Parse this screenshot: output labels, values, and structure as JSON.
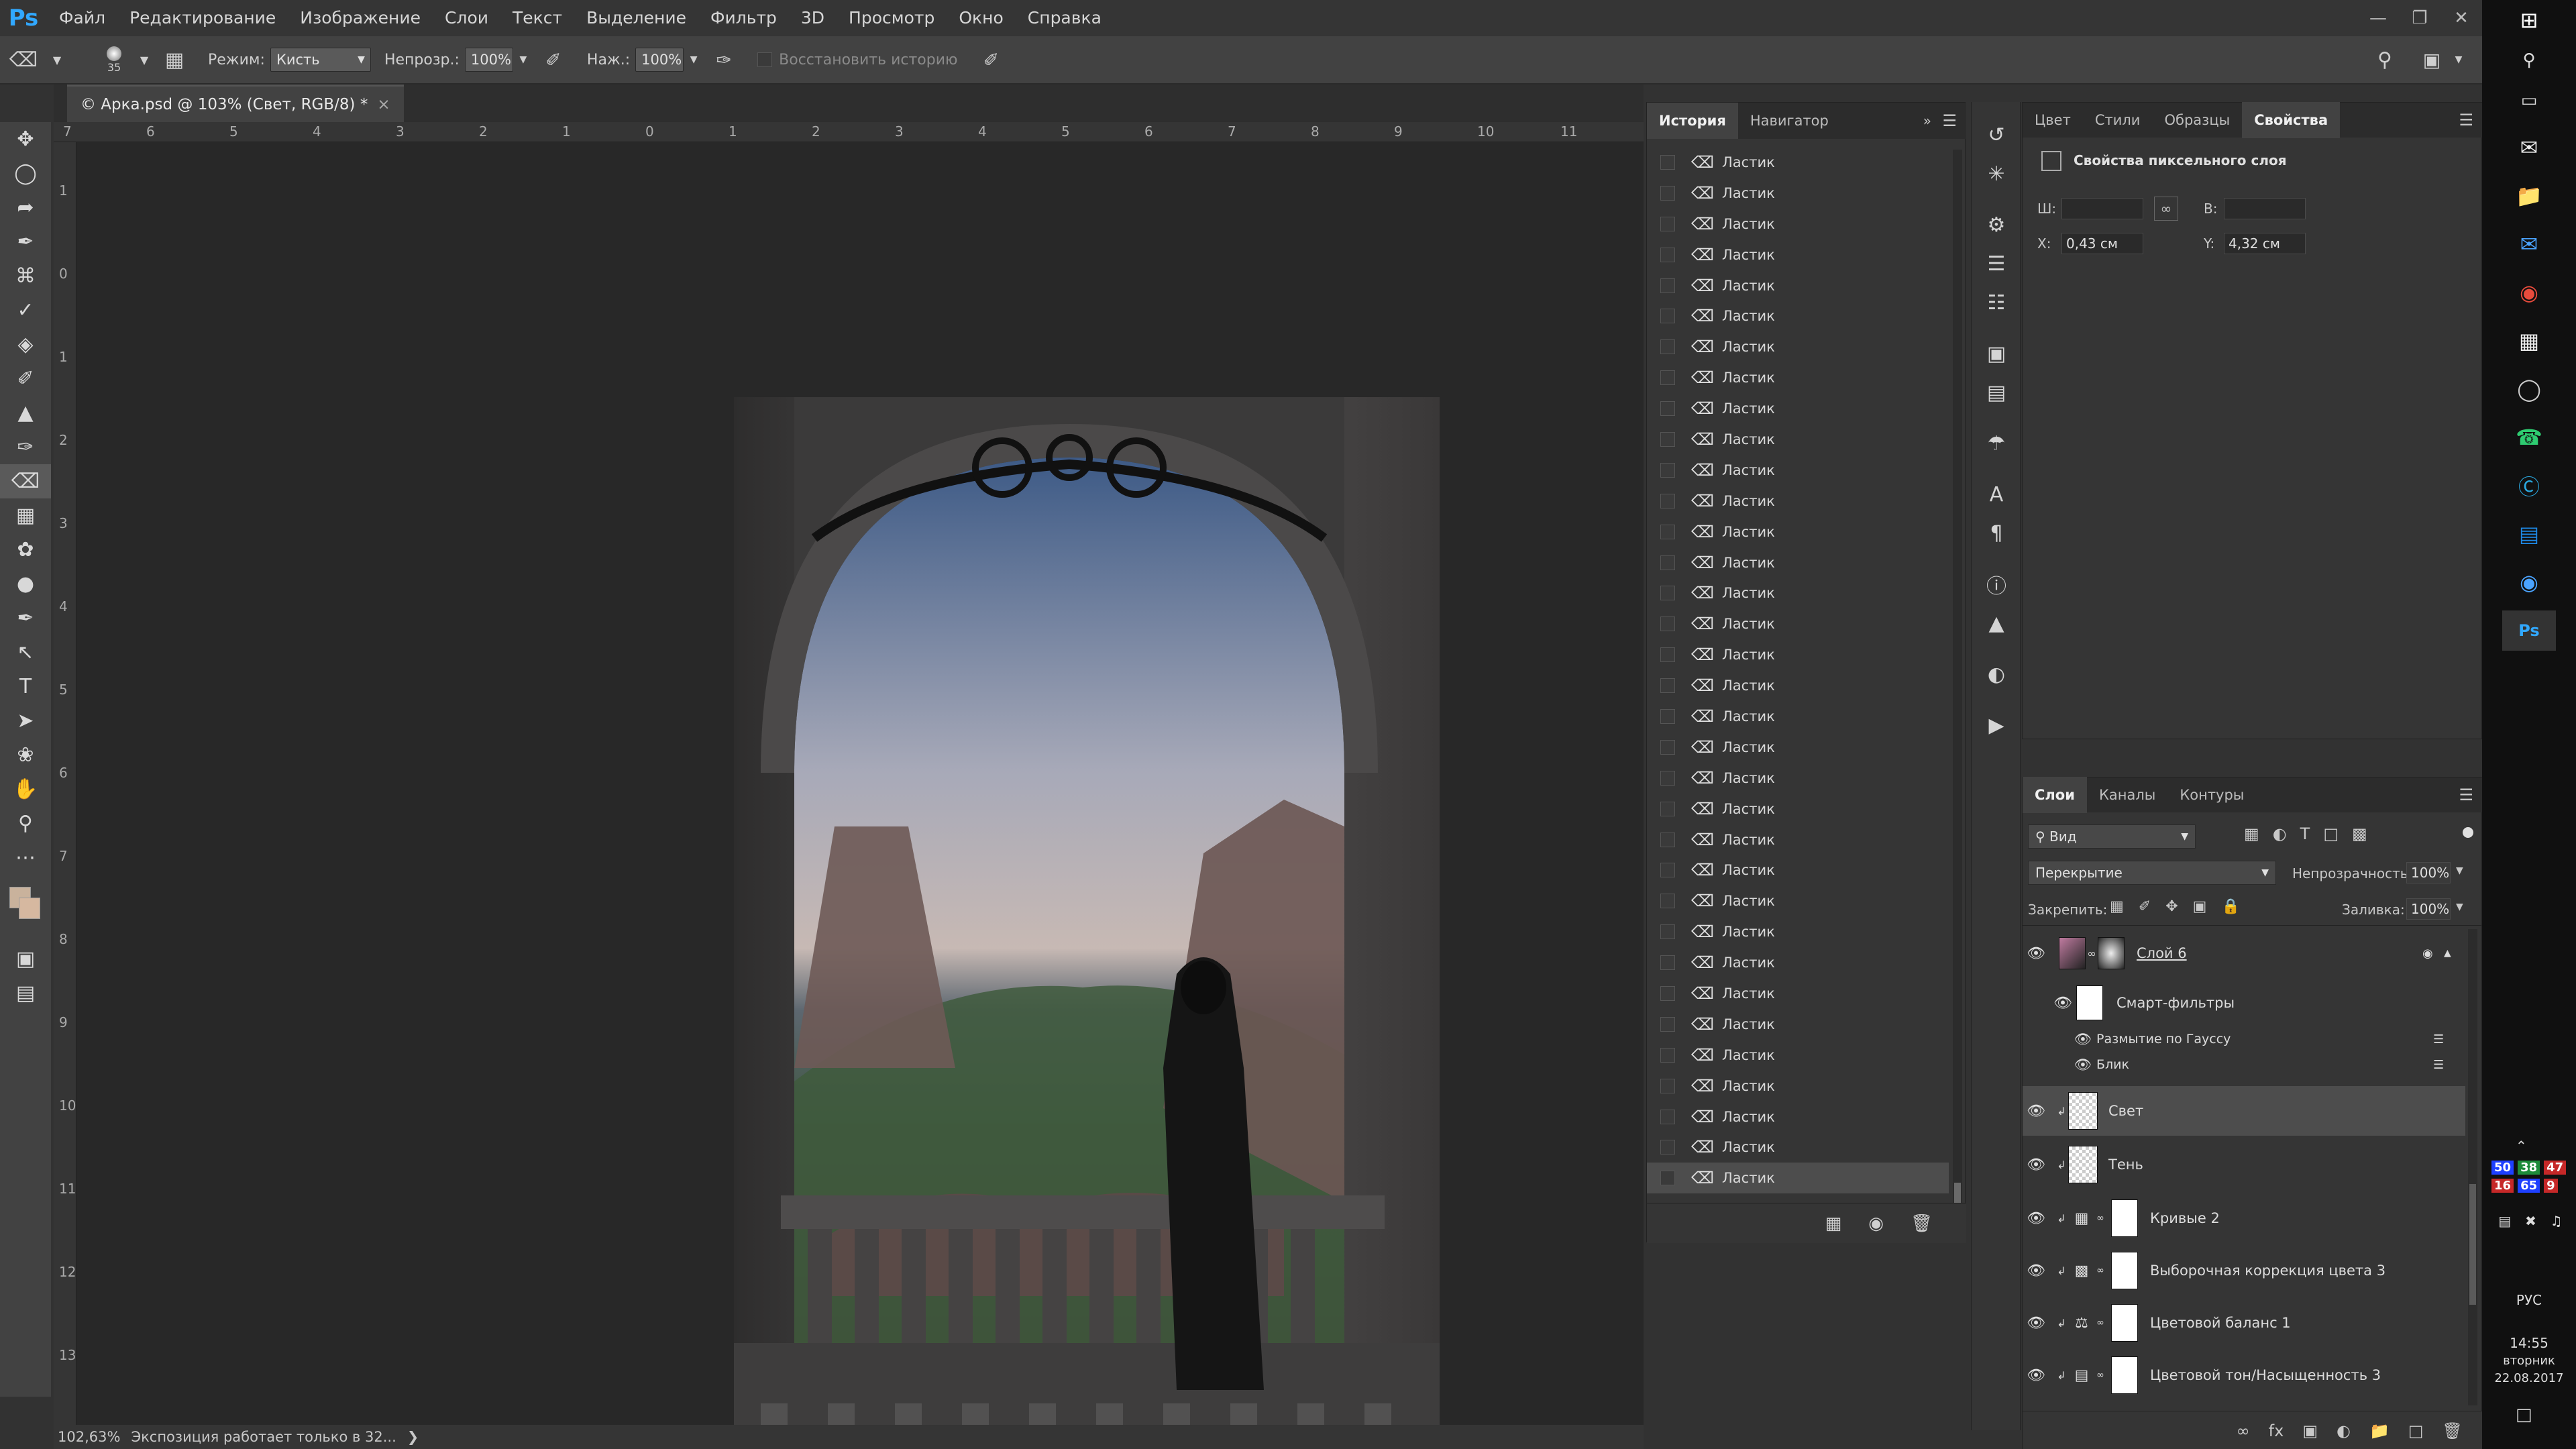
{
  "app": {
    "logo": "Ps"
  },
  "menu": [
    "Файл",
    "Редактирование",
    "Изображение",
    "Слои",
    "Текст",
    "Выделение",
    "Фильтр",
    "3D",
    "Просмотр",
    "Окно",
    "Справка"
  ],
  "options": {
    "brush_size": "35",
    "mode_label": "Режим:",
    "mode_value": "Кисть",
    "opacity_label": "Непрозр.:",
    "opacity_value": "100%",
    "pressure_label": "Наж.:",
    "pressure_value": "100%",
    "restore_history": "Восстановить историю"
  },
  "document": {
    "tab_title": "© Арка.psd @ 103% (Свет, RGB/8) *",
    "close": "×",
    "zoom": "102,63%",
    "status": "Экспозиция работает только в 32...",
    "ruler_top": [
      "7",
      "6",
      "5",
      "4",
      "3",
      "2",
      "1",
      "0",
      "1",
      "2",
      "3",
      "4",
      "5",
      "6",
      "7",
      "8",
      "9",
      "10",
      "11"
    ],
    "ruler_left": [
      "1",
      "0",
      "1",
      "2",
      "3",
      "4",
      "5",
      "6",
      "7",
      "8",
      "9",
      "10",
      "11",
      "12",
      "13"
    ]
  },
  "history": {
    "tabs": [
      "История",
      "Навигатор"
    ],
    "item_label": "Ластик",
    "count": 34
  },
  "properties": {
    "tabs": [
      "Цвет",
      "Стили",
      "Образцы",
      "Свойства"
    ],
    "title": "Свойства пиксельного слоя",
    "w_label": "Ш:",
    "h_label": "В:",
    "x_label": "X:",
    "x_value": "0,43 см",
    "y_label": "Y:",
    "y_value": "4,32 см"
  },
  "layers": {
    "tabs": [
      "Слои",
      "Каналы",
      "Контуры"
    ],
    "filter": "Вид",
    "blend": "Перекрытие",
    "opacity_label": "Непрозрачность:",
    "opacity_value": "100%",
    "lock_label": "Закрепить:",
    "fill_label": "Заливка:",
    "fill_value": "100%",
    "items": [
      {
        "name": "Слой 6",
        "kind": "smart"
      },
      {
        "name": "Смарт-фильтры",
        "kind": "filters"
      },
      {
        "name": "Размытие по Гауссу",
        "kind": "filter"
      },
      {
        "name": "Блик",
        "kind": "filter"
      },
      {
        "name": "Свет",
        "kind": "pixel"
      },
      {
        "name": "Тень",
        "kind": "pixel"
      },
      {
        "name": "Кривые 2",
        "kind": "adj"
      },
      {
        "name": "Выборочная коррекция цвета 3",
        "kind": "adj"
      },
      {
        "name": "Цветовой баланс 1",
        "kind": "adj"
      },
      {
        "name": "Цветовой тон/Насыщенность 3",
        "kind": "adj"
      }
    ]
  },
  "taskbar": {
    "lang": "РУС",
    "time": "14:55",
    "day": "вторник",
    "date": "22.08.2017",
    "tray": [
      "50",
      "38",
      "47",
      "16",
      "65",
      "9"
    ]
  },
  "colors": {
    "accent": "#31a8ff",
    "panel": "#353535",
    "selected": "#4d4d4d"
  }
}
